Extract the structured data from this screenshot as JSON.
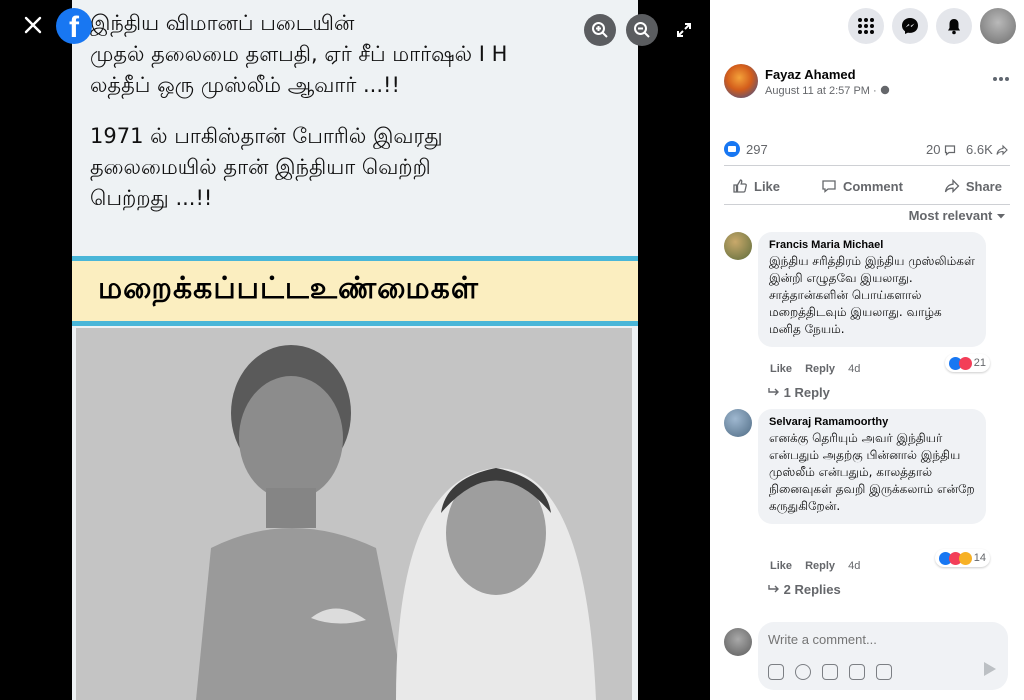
{
  "viewer": {
    "close_icon": "close-icon",
    "logo_letter": "f",
    "tools": [
      "zoom-in-icon",
      "zoom-out-icon",
      "expand-icon"
    ],
    "image_text": {
      "line1": "இந்திய விமானப் படையின்",
      "line2": "முதல் தலைமை தளபதி, ஏர் சீப் மார்ஷல் I H",
      "line3": "லத்தீப் ஒரு முஸ்லீம் ஆவார் ...!!",
      "line4": "1971 ல் பாகிஸ்தான் போரில் இவரது",
      "line5": "தலைமையில் தான் இந்தியா வெற்றி",
      "line6": "பெற்றது ...!!",
      "banner": "மறைக்கப்பட்டஉண்மைகள்"
    }
  },
  "post": {
    "author": "Fayaz Ahamed",
    "meta": "August 11 at 2:57 PM · ",
    "reactions": "297",
    "comments": "20",
    "shares": "6.6K",
    "actions": {
      "like": "Like",
      "comment": "Comment",
      "share": "Share"
    },
    "sort_label": "Most relevant"
  },
  "comments": [
    {
      "name": "Francis Maria Michael",
      "text": "இந்திய சரித்திரம் இந்திய முஸ்லிம்கள் இன்றி எழுதவே இயலாது. சாத்தான்களின் பொய்களால் மறைத்திடவும் இயலாது. வாழ்க மனித நேயம்.",
      "reaction_count": "21",
      "like": "Like",
      "reply": "Reply",
      "age": "4d",
      "replies": "1 Reply"
    },
    {
      "name": "Selvaraj Ramamoorthy",
      "text": "எனக்கு தெரியும் அவர் இந்தியர் என்பதும் அதற்கு பின்னால் இந்திய முஸ்லீம் என்பதும், காலத்தால் நினைவுகள் தவறி இருக்கலாம் என்றே கருதுகிறேன்.",
      "reaction_count": "14",
      "like": "Like",
      "reply": "Reply",
      "age": "4d",
      "replies": "2 Replies"
    }
  ],
  "composer": {
    "placeholder": "Write a comment..."
  },
  "colors": {
    "accent": "#1877f2",
    "bubble": "#f0f2f5",
    "banner_border": "#49b6d8",
    "banner_bg": "#fbeec0"
  }
}
